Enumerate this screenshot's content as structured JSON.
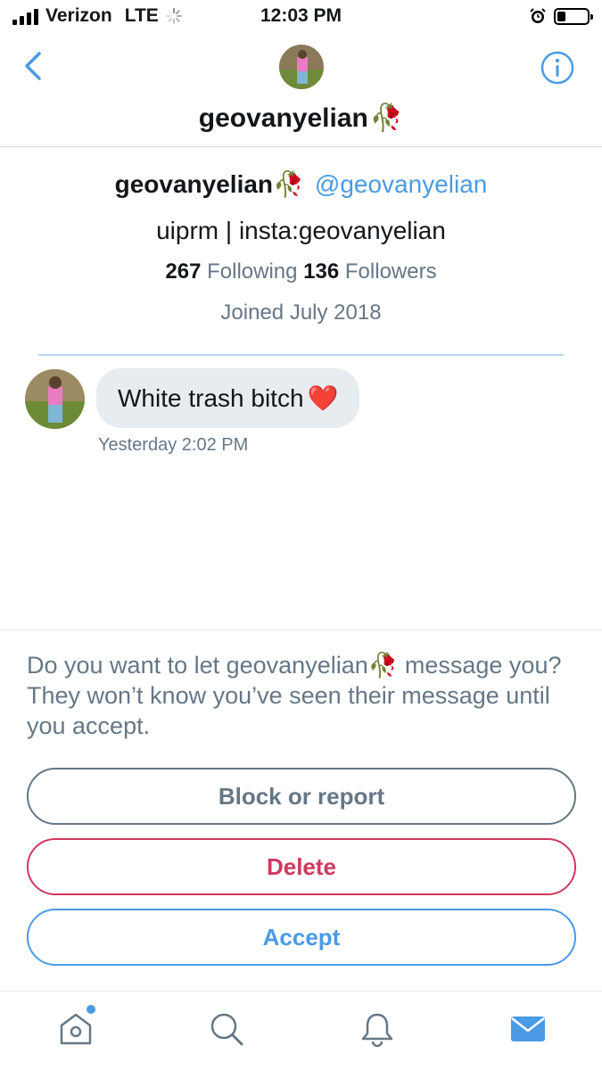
{
  "status_bar": {
    "carrier": "Verizon",
    "network": "LTE",
    "time": "12:03 PM",
    "icons": [
      "signal-icon",
      "loading-spinner-icon",
      "alarm-icon",
      "battery-icon"
    ]
  },
  "header": {
    "title": "geovanyelian",
    "title_emoji": "🥀",
    "icons": [
      "back-chevron-icon",
      "info-icon"
    ]
  },
  "profile": {
    "name": "geovanyelian",
    "name_emoji": "🥀",
    "handle": "@geovanyelian",
    "bio": "uiprm | insta:geovanyelian",
    "following_count": "267",
    "following_label": "Following",
    "followers_count": "136",
    "followers_label": "Followers",
    "joined": "Joined July 2018"
  },
  "message": {
    "text": "White trash bitch",
    "emoji": "❤️",
    "timestamp": "Yesterday 2:02 PM"
  },
  "request": {
    "text_before": "Do you want to let geovanyelian",
    "text_emoji": "🥀",
    "text_after": " message you? They won’t know you’ve seen their message until you accept.",
    "block_label": "Block or report",
    "delete_label": "Delete",
    "accept_label": "Accept"
  },
  "tabbar": {
    "tabs": [
      "home-icon",
      "search-icon",
      "notifications-bell-icon",
      "messages-envelope-icon"
    ],
    "active": "messages-envelope-icon"
  },
  "colors": {
    "accent": "#4a9ae5",
    "delete": "#d0385e",
    "muted": "#657786",
    "bubble": "#e6ecf0",
    "text": "#14171a"
  }
}
